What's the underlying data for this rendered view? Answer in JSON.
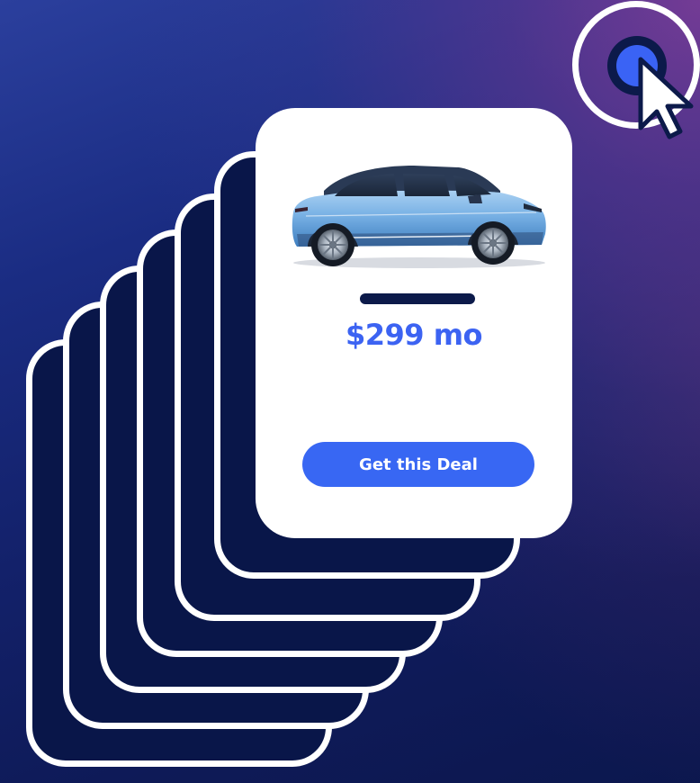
{
  "offer": {
    "price": "$299 mo",
    "cta_label": "Get this Deal"
  },
  "icons": {
    "target": "target-circle-icon",
    "pointer": "mouse-pointer-icon",
    "vehicle": "suv-car-image"
  },
  "colors": {
    "background_top": "#2b3f9d",
    "background_bottom": "#0c174e",
    "accent": "#3867f3",
    "card_dark": "#091649",
    "card_light": "#ffffff"
  }
}
